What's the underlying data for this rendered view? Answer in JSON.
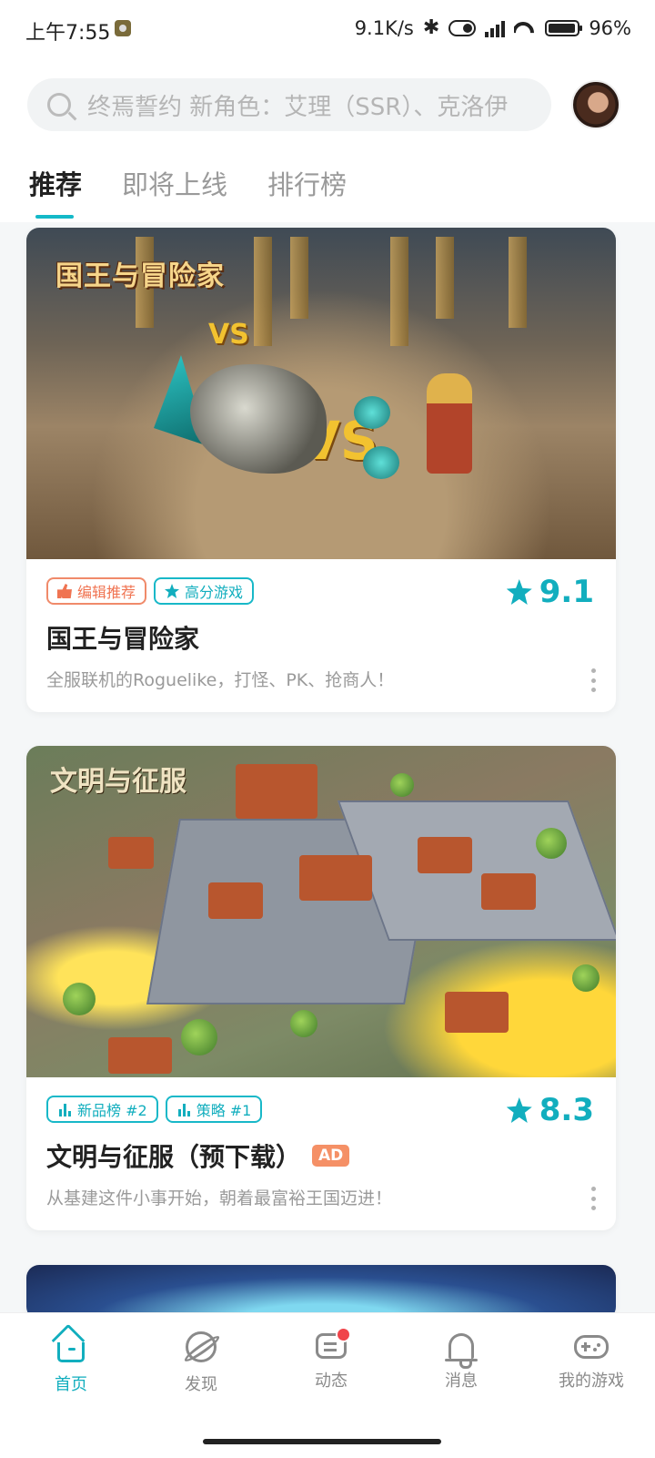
{
  "status_bar": {
    "time": "上午7:55",
    "speed": "9.1K/s",
    "battery": "96%"
  },
  "search": {
    "placeholder": "终焉誓约 新角色：艾理（SSR）、克洛伊"
  },
  "tabs": [
    {
      "label": "推荐",
      "active": true
    },
    {
      "label": "即将上线",
      "active": false
    },
    {
      "label": "排行榜",
      "active": false
    }
  ],
  "cards": [
    {
      "banner_logo": "国王与冒险家",
      "badges": [
        {
          "label": "编辑推荐",
          "icon": "thumbs-up-icon"
        },
        {
          "label": "高分游戏",
          "icon": "star-badge-icon"
        }
      ],
      "rating": "9.1",
      "title": "国王与冒险家",
      "ad_label": "",
      "description": "全服联机的Roguelike，打怪、PK、抢商人！"
    },
    {
      "banner_logo": "文明与征服",
      "badges": [
        {
          "label": "新品榜 #2",
          "icon": "rank-icon"
        },
        {
          "label": "策略 #1",
          "icon": "rank-icon"
        }
      ],
      "rating": "8.3",
      "title": "文明与征服（预下载）",
      "ad_label": "AD",
      "description": "从基建这件小事开始，朝着最富裕王国迈进！"
    }
  ],
  "nav": [
    {
      "label": "首页",
      "icon": "home-icon",
      "active": true
    },
    {
      "label": "发现",
      "icon": "discover-planet-icon",
      "active": false
    },
    {
      "label": "动态",
      "icon": "feed-chat-icon",
      "active": false,
      "has_dot": true
    },
    {
      "label": "消息",
      "icon": "bell-icon",
      "active": false
    },
    {
      "label": "我的游戏",
      "icon": "gamepad-icon",
      "active": false
    }
  ],
  "colors": {
    "accent": "#12aebe",
    "orange": "#f07452",
    "ad": "#f59066"
  }
}
